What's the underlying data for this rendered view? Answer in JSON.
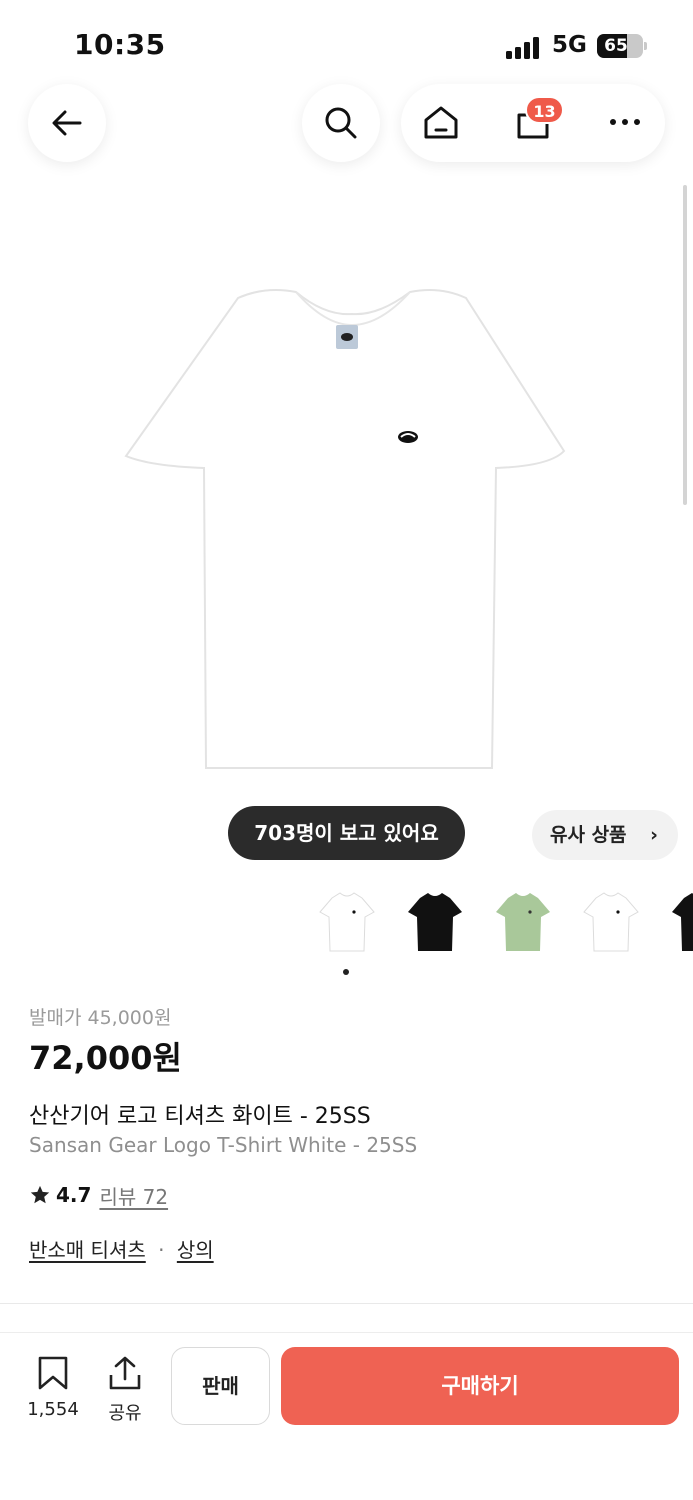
{
  "status_bar": {
    "time": "10:35",
    "network": "5G",
    "battery": "65",
    "battery_level": 0.65
  },
  "top_nav": {
    "back_icon": "arrow-left-icon",
    "search_icon": "search-icon",
    "home_icon": "home-icon",
    "cart_icon": "shopping-bag-icon",
    "cart_badge": "13",
    "more_icon": "more-horizontal-icon"
  },
  "gallery": {
    "viewers_text": "703명이 보고 있어요",
    "similar_label": "유사 상품",
    "similar_chevron": "›",
    "thumbnails": [
      {
        "color": "white"
      },
      {
        "color": "black"
      },
      {
        "color": "sage-green"
      },
      {
        "color": "white"
      },
      {
        "color": "black"
      }
    ],
    "pagination": {
      "current": 1
    }
  },
  "product": {
    "release_price": "발매가 45,000원",
    "price": "72,000원",
    "name_ko": "산산기어 로고 티셔츠 화이트 - 25SS",
    "name_en": "Sansan Gear Logo T-Shirt White - 25SS",
    "rating": "4.7",
    "reviews_label": "리뷰 72",
    "category_1": "반소매 티셔츠",
    "category_sep": "·",
    "category_2": "상의"
  },
  "bottom_bar": {
    "bookmark_count": "1,554",
    "share_label": "공유",
    "sell_label": "판매",
    "buy_label": "구매하기"
  },
  "colors": {
    "accent": "#ef6253",
    "badge": "#ef5a4a",
    "viewers_bg": "#2b2b2b",
    "thumb_green": "#a9c89a"
  }
}
